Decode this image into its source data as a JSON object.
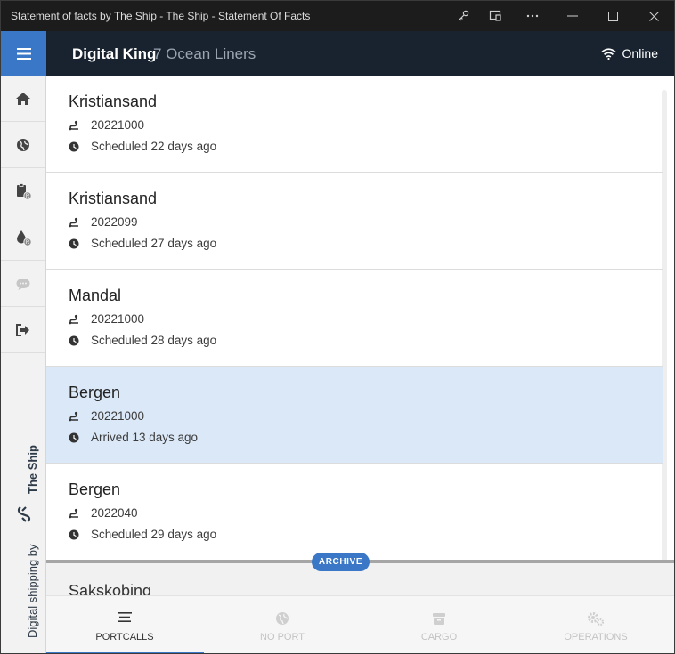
{
  "window": {
    "title": "Statement of facts by The Ship - The Ship - Statement Of Facts"
  },
  "header": {
    "ship": "Digital King",
    "company": "7 Ocean Liners",
    "status": "Online"
  },
  "sidebar": {
    "items": [
      {
        "icon": "home-icon"
      },
      {
        "icon": "globe-icon"
      },
      {
        "icon": "clipboard-icon"
      },
      {
        "icon": "drop-icon"
      },
      {
        "icon": "chat-icon"
      },
      {
        "icon": "logout-icon"
      }
    ],
    "brand_prefix": "Digital shipping by ",
    "brand_name": "The Ship"
  },
  "portcalls": [
    {
      "port": "Kristiansand",
      "voyage": "20221000",
      "status": "Scheduled 22 days ago",
      "selected": false
    },
    {
      "port": "Kristiansand",
      "voyage": "2022099",
      "status": "Scheduled 27 days ago",
      "selected": false
    },
    {
      "port": "Mandal",
      "voyage": "20221000",
      "status": "Scheduled 28 days ago",
      "selected": false
    },
    {
      "port": "Bergen",
      "voyage": "20221000",
      "status": "Arrived 13 days ago",
      "selected": true
    },
    {
      "port": "Bergen",
      "voyage": "2022040",
      "status": "Scheduled 29 days ago",
      "selected": false
    }
  ],
  "archive": {
    "label": "ARCHIVE",
    "first_port": "Sakskobing"
  },
  "tabs": [
    {
      "label": "PORTCALLS",
      "icon": "list-icon",
      "active": true
    },
    {
      "label": "NO PORT",
      "icon": "globe-icon",
      "active": false
    },
    {
      "label": "CARGO",
      "icon": "cargo-icon",
      "active": false
    },
    {
      "label": "OPERATIONS",
      "icon": "gears-icon",
      "active": false
    }
  ],
  "colors": {
    "accent": "#3a78c7",
    "header_bg": "#18232f",
    "selected_row": "#dbe8f7"
  }
}
